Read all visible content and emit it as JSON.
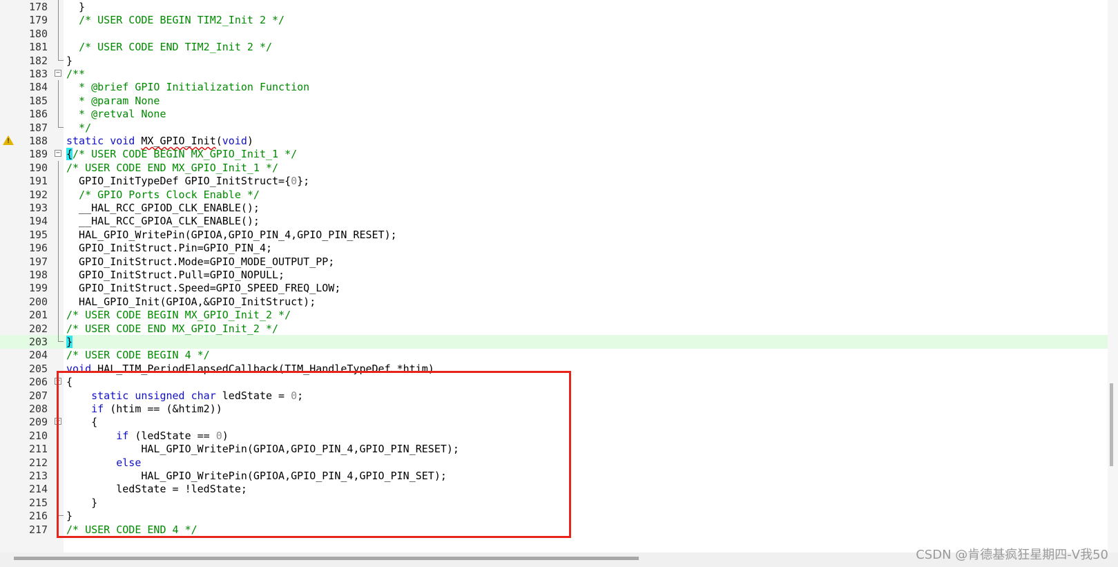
{
  "colors": {
    "keyword": "#1010c8",
    "comment": "#008a00",
    "number": "#8a8a8a",
    "highlight_line": "#e2fbe2",
    "brace_match": "#2ee8f0",
    "annotation_box": "#e8231a"
  },
  "editor": {
    "lines": [
      {
        "n": "178",
        "segs": [
          [
            "p",
            "  }"
          ]
        ]
      },
      {
        "n": "179",
        "segs": [
          [
            "p",
            "  "
          ],
          [
            "c",
            "/* USER CODE BEGIN TIM2_Init 2 */"
          ]
        ]
      },
      {
        "n": "180",
        "segs": []
      },
      {
        "n": "181",
        "segs": [
          [
            "p",
            "  "
          ],
          [
            "c",
            "/* USER CODE END TIM2_Init 2 */"
          ]
        ]
      },
      {
        "n": "182",
        "segs": [
          [
            "p",
            "}"
          ]
        ]
      },
      {
        "n": "183",
        "segs": [
          [
            "c",
            "/**"
          ]
        ]
      },
      {
        "n": "184",
        "segs": [
          [
            "c",
            "  * @brief GPIO Initialization Function"
          ]
        ]
      },
      {
        "n": "185",
        "segs": [
          [
            "c",
            "  * @param None"
          ]
        ]
      },
      {
        "n": "186",
        "segs": [
          [
            "c",
            "  * @retval None"
          ]
        ]
      },
      {
        "n": "187",
        "segs": [
          [
            "c",
            "  */"
          ]
        ]
      },
      {
        "n": "188",
        "segs": [
          [
            "k",
            "static"
          ],
          [
            "p",
            " "
          ],
          [
            "k",
            "void"
          ],
          [
            "p",
            " "
          ],
          [
            "w",
            "MX_GPIO_Init"
          ],
          [
            "p",
            "("
          ],
          [
            "k",
            "void"
          ],
          [
            "p",
            ")"
          ]
        ]
      },
      {
        "n": "189",
        "segs": [
          [
            "b",
            "{"
          ],
          [
            "c",
            "/* USER CODE BEGIN MX_GPIO_Init_1 */"
          ]
        ]
      },
      {
        "n": "190",
        "segs": [
          [
            "c",
            "/* USER CODE END MX_GPIO_Init_1 */"
          ]
        ]
      },
      {
        "n": "191",
        "segs": [
          [
            "p",
            "  GPIO_InitTypeDef GPIO_InitStruct={"
          ],
          [
            "n",
            "0"
          ],
          [
            "p",
            "};"
          ]
        ]
      },
      {
        "n": "192",
        "segs": [
          [
            "p",
            "  "
          ],
          [
            "c",
            "/* GPIO Ports Clock Enable */"
          ]
        ]
      },
      {
        "n": "193",
        "segs": [
          [
            "p",
            "  __HAL_RCC_GPIOD_CLK_ENABLE();"
          ]
        ]
      },
      {
        "n": "194",
        "segs": [
          [
            "p",
            "  __HAL_RCC_GPIOA_CLK_ENABLE();"
          ]
        ]
      },
      {
        "n": "195",
        "segs": [
          [
            "p",
            "  HAL_GPIO_WritePin(GPIOA,GPIO_PIN_4,GPIO_PIN_RESET);"
          ]
        ]
      },
      {
        "n": "196",
        "segs": [
          [
            "p",
            "  GPIO_InitStruct.Pin=GPIO_PIN_4;"
          ]
        ]
      },
      {
        "n": "197",
        "segs": [
          [
            "p",
            "  GPIO_InitStruct.Mode=GPIO_MODE_OUTPUT_PP;"
          ]
        ]
      },
      {
        "n": "198",
        "segs": [
          [
            "p",
            "  GPIO_InitStruct.Pull=GPIO_NOPULL;"
          ]
        ]
      },
      {
        "n": "199",
        "segs": [
          [
            "p",
            "  GPIO_InitStruct.Speed=GPIO_SPEED_FREQ_LOW;"
          ]
        ]
      },
      {
        "n": "200",
        "segs": [
          [
            "p",
            "  HAL_GPIO_Init(GPIOA,&GPIO_InitStruct);"
          ]
        ]
      },
      {
        "n": "201",
        "segs": [
          [
            "c",
            "/* USER CODE BEGIN MX_GPIO_Init_2 */"
          ]
        ]
      },
      {
        "n": "202",
        "segs": [
          [
            "c",
            "/* USER CODE END MX_GPIO_Init_2 */"
          ]
        ]
      },
      {
        "n": "203",
        "segs": [
          [
            "b",
            "}"
          ]
        ]
      },
      {
        "n": "204",
        "segs": [
          [
            "c",
            "/* USER CODE BEGIN 4 */"
          ]
        ]
      },
      {
        "n": "205",
        "segs": [
          [
            "k",
            "void"
          ],
          [
            "p",
            " HAL_TIM_PeriodElapsedCallback(TIM_HandleTypeDef *htim)"
          ]
        ]
      },
      {
        "n": "206",
        "segs": [
          [
            "p",
            "{"
          ]
        ]
      },
      {
        "n": "207",
        "segs": [
          [
            "p",
            "    "
          ],
          [
            "k",
            "static"
          ],
          [
            "p",
            " "
          ],
          [
            "k",
            "unsigned"
          ],
          [
            "p",
            " "
          ],
          [
            "k",
            "char"
          ],
          [
            "p",
            " ledState = "
          ],
          [
            "n",
            "0"
          ],
          [
            "p",
            ";"
          ]
        ]
      },
      {
        "n": "208",
        "segs": [
          [
            "p",
            "    "
          ],
          [
            "k",
            "if"
          ],
          [
            "p",
            " (htim == (&htim2))"
          ]
        ]
      },
      {
        "n": "209",
        "segs": [
          [
            "p",
            "    {"
          ]
        ]
      },
      {
        "n": "210",
        "segs": [
          [
            "p",
            "        "
          ],
          [
            "k",
            "if"
          ],
          [
            "p",
            " (ledState == "
          ],
          [
            "n",
            "0"
          ],
          [
            "p",
            ")"
          ]
        ]
      },
      {
        "n": "211",
        "segs": [
          [
            "p",
            "            HAL_GPIO_WritePin(GPIOA,GPIO_PIN_4,GPIO_PIN_RESET);"
          ]
        ]
      },
      {
        "n": "212",
        "segs": [
          [
            "p",
            "        "
          ],
          [
            "k",
            "else"
          ]
        ]
      },
      {
        "n": "213",
        "segs": [
          [
            "p",
            "            HAL_GPIO_WritePin(GPIOA,GPIO_PIN_4,GPIO_PIN_SET);"
          ]
        ]
      },
      {
        "n": "214",
        "segs": [
          [
            "p",
            "        ledState = !ledState;"
          ]
        ]
      },
      {
        "n": "215",
        "segs": [
          [
            "p",
            "    }"
          ]
        ]
      },
      {
        "n": "216",
        "segs": [
          [
            "p",
            "}"
          ]
        ]
      },
      {
        "n": "217",
        "segs": [
          [
            "c",
            "/* USER CODE END 4 */"
          ]
        ]
      }
    ]
  },
  "gutter": {
    "warning_line": "188",
    "warning_icon": "warning-triangle-icon",
    "fold_open_lines": [
      "183",
      "189",
      "206",
      "209"
    ],
    "fold_end_lines": [
      "182",
      "187",
      "203",
      "216"
    ],
    "highlighted_line": "203"
  },
  "watermark": "CSDN @肯德基疯狂星期四-V我50"
}
